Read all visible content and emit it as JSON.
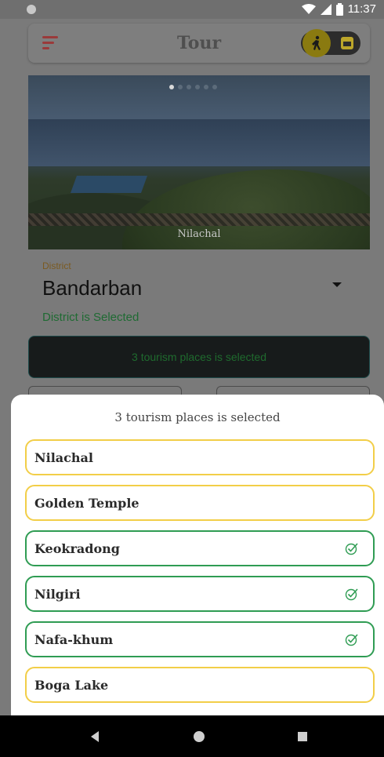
{
  "status_bar": {
    "time": "11:37",
    "icons": [
      "notification-dot-icon",
      "wifi-icon",
      "signal-icon",
      "battery-icon"
    ]
  },
  "app_bar": {
    "title": "Tour",
    "menu_icon": "menu-icon",
    "toggle": {
      "active_icon": "walking-icon",
      "inactive_icon": "calendar-icon"
    }
  },
  "banner": {
    "caption": "Nilachal",
    "slides": 6,
    "active_slide": 1
  },
  "district": {
    "label": "District",
    "value": "Bandarban",
    "status": "District is Selected"
  },
  "selected_summary": "3 tourism places is selected",
  "sheet": {
    "title": "3 tourism places is selected",
    "places": [
      {
        "name": "Nilachal",
        "selected": false
      },
      {
        "name": "Golden Temple",
        "selected": false
      },
      {
        "name": "Keokradong",
        "selected": true
      },
      {
        "name": "Nilgiri",
        "selected": true
      },
      {
        "name": "Nafa-khum",
        "selected": true
      },
      {
        "name": "Boga Lake",
        "selected": false
      }
    ]
  },
  "colors": {
    "selected_border": "#2f9c53",
    "unselected_border": "#f2ce48",
    "accent_yellow": "#f2ce48",
    "menu_red": "#d23c3c"
  },
  "nav_bar": {
    "icons": [
      "back-icon",
      "home-icon",
      "recents-icon"
    ]
  }
}
